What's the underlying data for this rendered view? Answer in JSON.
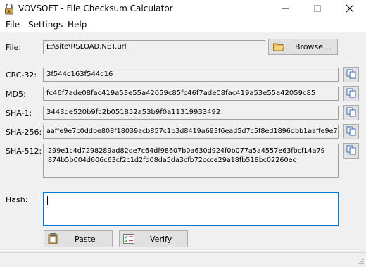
{
  "window": {
    "title": "VOVSOFT - File Checksum Calculator",
    "icon": "lock-icon",
    "controls": [
      "minimize-icon",
      "maximize-icon",
      "close-icon"
    ]
  },
  "menu": {
    "file": "File",
    "settings": "Settings",
    "help": "Help"
  },
  "file_row": {
    "label": "File:",
    "path": "E:\\site\\RSLOAD.NET.url",
    "browse_label": "Browse...",
    "browse_icon": "folder-icon"
  },
  "checksums": {
    "crc32": {
      "label": "CRC-32:",
      "value": "3f544c163f544c16"
    },
    "md5": {
      "label": "MD5:",
      "value": "fc46f7ade08fac419a53e55a42059c85fc46f7ade08fac419a53e55a42059c85"
    },
    "sha1": {
      "label": "SHA-1:",
      "value": "3443de520b9fc2b051852a53b9f0a11319933492"
    },
    "sha256": {
      "label": "SHA-256:",
      "value": "aaffe9e7c0ddbe808f18039acb857c1b3d8419a693f6ead5d7c5f8ed1896dbb1aaffe9e7"
    },
    "sha512": {
      "label": "SHA-512:",
      "value": "299e1c4d7298289ad82de7c64df98607b0a630d924f0b077a5a4557e63fbcf14a79874b5b004d606c63cf2c1d2fd08da5da3cfb72ccce29a18fb518bc02260ec"
    }
  },
  "copy_icon": "copy-icon",
  "hash": {
    "label": "Hash:",
    "value": ""
  },
  "buttons": {
    "paste": "Paste",
    "verify": "Verify",
    "paste_icon": "clipboard-icon",
    "verify_icon": "checklist-icon"
  },
  "colors": {
    "focus_border": "#0078d7",
    "title_bg": "#ffffff",
    "window_bg": "#f0f0f0"
  }
}
